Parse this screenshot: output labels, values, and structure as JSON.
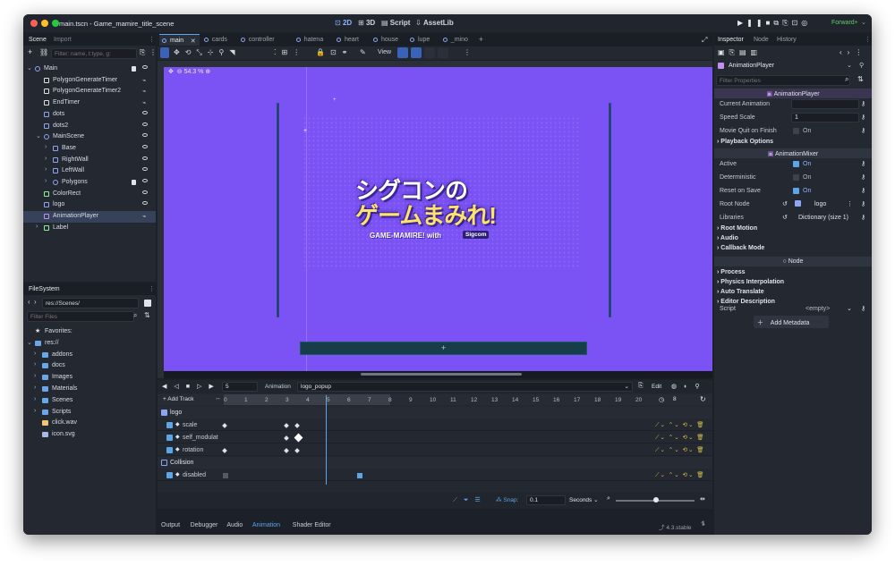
{
  "window": {
    "title": "main.tscn - Game_mamire_title_scene"
  },
  "modes": [
    {
      "icon": "2d-icon",
      "label": "2D"
    },
    {
      "icon": "3d-icon",
      "label": "3D"
    },
    {
      "icon": "script-icon",
      "label": "Script"
    },
    {
      "icon": "assetlib-icon",
      "label": "AssetLib"
    }
  ],
  "renderer": "Forward+",
  "scene_dock": {
    "tabs": [
      "Scene",
      "Import"
    ],
    "filter_placeholder": "Filter: name, t:type, g:",
    "nodes": [
      {
        "label": "Main",
        "depth": 0,
        "icon": "node2d-icon",
        "color": "#8da5f3"
      },
      {
        "label": "PolygonGenerateTimer",
        "depth": 1,
        "icon": "timer-icon",
        "color": "#e0e0e0"
      },
      {
        "label": "PolygonGenerateTimer2",
        "depth": 1,
        "icon": "timer-icon",
        "color": "#e0e0e0"
      },
      {
        "label": "EndTimer",
        "depth": 1,
        "icon": "timer-icon",
        "color": "#e0e0e0"
      },
      {
        "label": "dots",
        "depth": 1,
        "icon": "sprite-icon",
        "color": "#8da5f3"
      },
      {
        "label": "dots2",
        "depth": 1,
        "icon": "sprite-icon",
        "color": "#8da5f3"
      },
      {
        "label": "MainScene",
        "depth": 1,
        "icon": "node2d-icon",
        "color": "#8da5f3"
      },
      {
        "label": "Base",
        "depth": 2,
        "icon": "body-icon",
        "color": "#8da5f3"
      },
      {
        "label": "RightWall",
        "depth": 2,
        "icon": "body-icon",
        "color": "#8da5f3"
      },
      {
        "label": "LeftWall",
        "depth": 2,
        "icon": "body-icon",
        "color": "#8da5f3"
      },
      {
        "label": "Polygons",
        "depth": 2,
        "icon": "node2d-icon",
        "color": "#8da5f3"
      },
      {
        "label": "ColorRect",
        "depth": 1,
        "icon": "colorrect-icon",
        "color": "#8eef97"
      },
      {
        "label": "logo",
        "depth": 1,
        "icon": "sprite-icon",
        "color": "#8da5f3"
      },
      {
        "label": "AnimationPlayer",
        "depth": 1,
        "icon": "animationplayer-icon",
        "color": "#c38ef1"
      },
      {
        "label": "Label",
        "depth": 1,
        "icon": "label-icon",
        "color": "#8eef97"
      }
    ]
  },
  "filesystem": {
    "tab": "FileSystem",
    "path": "res://Scenes/",
    "filter_placeholder": "Filter Files",
    "items": [
      {
        "label": "Favorites:",
        "depth": 0,
        "icon": "star-icon"
      },
      {
        "label": "res://",
        "depth": 0,
        "icon": "folder-icon"
      },
      {
        "label": "addons",
        "depth": 1,
        "icon": "folder-icon"
      },
      {
        "label": "docs",
        "depth": 1,
        "icon": "folder-icon"
      },
      {
        "label": "Images",
        "depth": 1,
        "icon": "folder-icon"
      },
      {
        "label": "Materials",
        "depth": 1,
        "icon": "folder-icon"
      },
      {
        "label": "Scenes",
        "depth": 1,
        "icon": "folder-icon"
      },
      {
        "label": "Scripts",
        "depth": 1,
        "icon": "folder-icon"
      },
      {
        "label": "click.wav",
        "depth": 1,
        "icon": "audio-icon"
      },
      {
        "label": "icon.svg",
        "depth": 1,
        "icon": "image-icon"
      }
    ]
  },
  "editor_tabs": [
    "main",
    "cards",
    "controller",
    "hatena",
    "heart",
    "house",
    "lupe",
    "_mino"
  ],
  "toolbar": {
    "view": "View"
  },
  "viewport": {
    "zoom": "54.3 %",
    "logo_line1": "シグコンの",
    "logo_line2": "ゲームまみれ!",
    "logo_sub": "GAME-MAMIRE! with",
    "logo_badge": "Sigcom"
  },
  "animation": {
    "frame": "5",
    "anim_label": "Animation",
    "anim_name": "logo_popup",
    "edit": "Edit",
    "add_track": "+ Add Track",
    "end_time": "8",
    "ticks": [
      "0",
      "1",
      "2",
      "3",
      "4",
      "5",
      "6",
      "7",
      "8",
      "9",
      "10",
      "11",
      "12",
      "13",
      "14",
      "15",
      "16",
      "17",
      "18",
      "19",
      "20"
    ],
    "groups": [
      {
        "name": "logo",
        "tracks": [
          "scale",
          "self_modulat",
          "rotation"
        ]
      },
      {
        "name": "Collision",
        "tracks": [
          "disabled"
        ]
      }
    ],
    "snap_label": "Snap:",
    "snap": "0.1",
    "snap_unit": "Seconds"
  },
  "bottom_tabs": [
    "Output",
    "Debugger",
    "Audio",
    "Animation",
    "Shader Editor"
  ],
  "version": "4.3.stable",
  "inspector": {
    "tabs": [
      "Inspector",
      "Node",
      "History"
    ],
    "node": "AnimationPlayer",
    "filter_placeholder": "Filter Properties",
    "section_player": "AnimationPlayer",
    "current_animation": "Current Animation",
    "speed_scale": "Speed Scale",
    "speed_value": "1",
    "movie_quit": "Movie Quit on Finish",
    "movie_quit_value": "On",
    "playback_options": "Playback Options",
    "section_mixer": "AnimationMixer",
    "active": "Active",
    "active_value": "On",
    "deterministic": "Deterministic",
    "deterministic_value": "On",
    "reset_on_save": "Reset on Save",
    "reset_value": "On",
    "root_node": "Root Node",
    "root_node_value": "logo",
    "libraries": "Libraries",
    "libraries_value": "Dictionary (size 1)",
    "groups_mixer": [
      "Root Motion",
      "Audio",
      "Callback Mode"
    ],
    "section_node": "Node",
    "groups_node": [
      "Process",
      "Physics Interpolation",
      "Auto Translate",
      "Editor Description"
    ],
    "script": "Script",
    "script_value": "<empty>",
    "add_metadata": "Add Metadata"
  }
}
